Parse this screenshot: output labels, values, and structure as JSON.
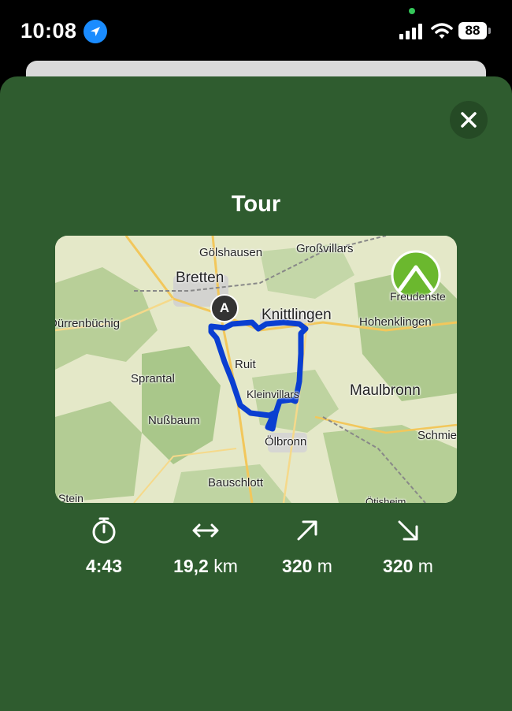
{
  "status_bar": {
    "time": "10:08",
    "battery": "88"
  },
  "sheet": {
    "title": "Tour"
  },
  "map": {
    "start_marker": "A",
    "labels": {
      "goelshausen": "Gölshausen",
      "grossvillars": "Großvillars",
      "bretten": "Bretten",
      "knittlingen": "Knittlingen",
      "freudenstein": "Freudenste",
      "duerrenbuechig": "Dürrenbüchig",
      "hohenklingen": "Hohenklingen",
      "ruit": "Ruit",
      "sprantal": "Sprantal",
      "maulbronn": "Maulbronn",
      "kleinvillars": "Kleinvillars",
      "nussbaum": "Nußbaum",
      "schmie": "Schmie",
      "oelbronn": "Ölbronn",
      "bauschlott": "Bauschlott",
      "stein": "Stein",
      "oetisheim": "Ötisheim"
    }
  },
  "stats": {
    "duration": {
      "value": "4:43",
      "unit": ""
    },
    "distance": {
      "value": "19,2",
      "unit": "km"
    },
    "ascent": {
      "value": "320",
      "unit": "m"
    },
    "descent": {
      "value": "320",
      "unit": "m"
    }
  },
  "colors": {
    "sheet": "#2f5c2f",
    "route": "#0a3fd1",
    "logo": "#6bb82e",
    "accent_blue": "#1a8cff"
  }
}
